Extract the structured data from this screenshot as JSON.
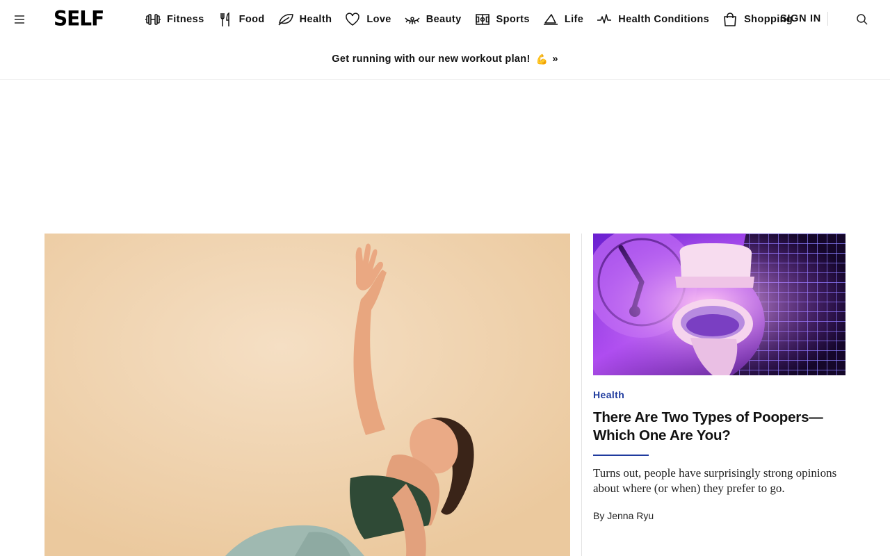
{
  "header": {
    "menu_icon": "hamburger-menu-icon",
    "logo": "SELF",
    "nav": [
      {
        "label": "Fitness",
        "icon": "dumbbell-icon"
      },
      {
        "label": "Food",
        "icon": "fork-knife-icon"
      },
      {
        "label": "Health",
        "icon": "leaf-icon"
      },
      {
        "label": "Love",
        "icon": "heart-icon"
      },
      {
        "label": "Beauty",
        "icon": "eyelash-icon"
      },
      {
        "label": "Sports",
        "icon": "field-icon"
      },
      {
        "label": "Life",
        "icon": "sailboat-icon"
      },
      {
        "label": "Health Conditions",
        "icon": "pulse-icon"
      },
      {
        "label": "Shopping",
        "icon": "shopping-bag-icon"
      }
    ],
    "sign_in": "SIGN IN",
    "search_icon": "search-icon"
  },
  "promo": {
    "text": "Get running with our new workout plan!",
    "emoji": "💪",
    "arrow": "»"
  },
  "hero": {
    "image_alt": "Woman in green sports bra stretching with one arm raised"
  },
  "side_story": {
    "image_alt": "Purple toilet with melting clock and grid",
    "category": "Health",
    "title": "There Are Two Types of Poopers—Which One Are You?",
    "dek": "Turns out, people have surprisingly strong opinions about where (or when) they prefer to go.",
    "byline_prefix": "By ",
    "author": "Jenna Ryu"
  },
  "colors": {
    "accent": "#1f3b9e",
    "text": "#111111",
    "hero_bg": "#efd2ac"
  }
}
